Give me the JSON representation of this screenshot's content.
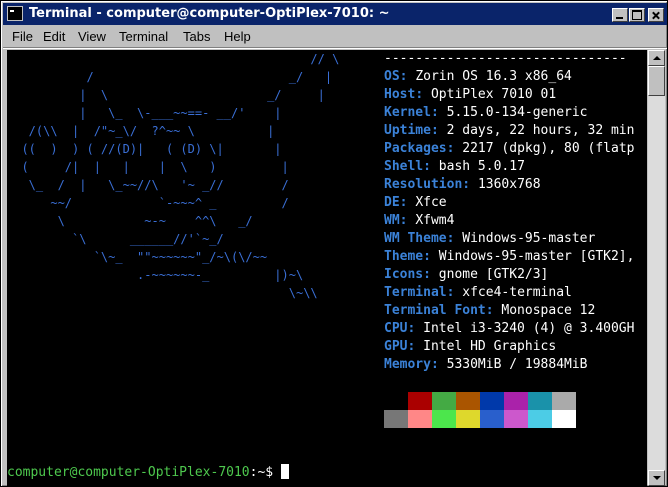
{
  "window": {
    "title": "Terminal - computer@computer-OptiPlex-7010: ~"
  },
  "menu": [
    "File",
    "Edit",
    "View",
    "Terminal",
    "Tabs",
    "Help"
  ],
  "ascii_art": "                                          // \\\n           /                           _/   |\n          |  \\                      _/     |\n          |   \\_  \\-___~~==- __/'    |\n   /(\\\\  |  /\"~_\\/  ?^~~ \\          |\n  ((  )  ) ( //(D)|   ( (D) \\|       |\n  (     /|  |   |    |  \\   )         |\n   \\_  /  |   \\_~~//\\   '~ _//        /\n      ~~/            `-~~~^ _         /\n       \\           ~-~    ^^\\   _/\n         `\\      ______//'`~_/\n            `\\~_  \"\"~~~~~~\"_/~\\(\\/~~\n                  .-~~~~~~-_         |)~\\\n                                       \\~\\\\",
  "info": {
    "separator": "-------------------------------",
    "items": [
      {
        "key": "OS",
        "value": "Zorin OS 16.3 x86_64"
      },
      {
        "key": "Host",
        "value": "OptiPlex 7010 01"
      },
      {
        "key": "Kernel",
        "value": "5.15.0-134-generic"
      },
      {
        "key": "Uptime",
        "value": "2 days, 22 hours, 32 min"
      },
      {
        "key": "Packages",
        "value": "2217 (dpkg), 80 (flatp"
      },
      {
        "key": "Shell",
        "value": "bash 5.0.17"
      },
      {
        "key": "Resolution",
        "value": "1360x768"
      },
      {
        "key": "DE",
        "value": "Xfce"
      },
      {
        "key": "WM",
        "value": "Xfwm4"
      },
      {
        "key": "WM Theme",
        "value": "Windows-95-master"
      },
      {
        "key": "Theme",
        "value": "Windows-95-master [GTK2],"
      },
      {
        "key": "Icons",
        "value": "gnome [GTK2/3]"
      },
      {
        "key": "Terminal",
        "value": "xfce4-terminal"
      },
      {
        "key": "Terminal Font",
        "value": "Monospace 12"
      },
      {
        "key": "CPU",
        "value": "Intel i3-3240 (4) @ 3.400GH"
      },
      {
        "key": "GPU",
        "value": "Intel HD Graphics"
      },
      {
        "key": "Memory",
        "value": "5330MiB / 19884MiB"
      }
    ]
  },
  "palette": {
    "normal": [
      "#000000",
      "#aa0000",
      "#44aa44",
      "#aa5500",
      "#0039aa",
      "#aa22aa",
      "#1a92aa",
      "#aaaaaa"
    ],
    "bright": [
      "#777777",
      "#ff8787",
      "#4ce64c",
      "#ded82c",
      "#295fcc",
      "#cc58cc",
      "#4ccce6",
      "#ffffff"
    ]
  },
  "prompt": {
    "user_host": "computer@computer-OptiPlex-7010",
    "sep": ":",
    "path": "~",
    "symbol": "$ "
  }
}
